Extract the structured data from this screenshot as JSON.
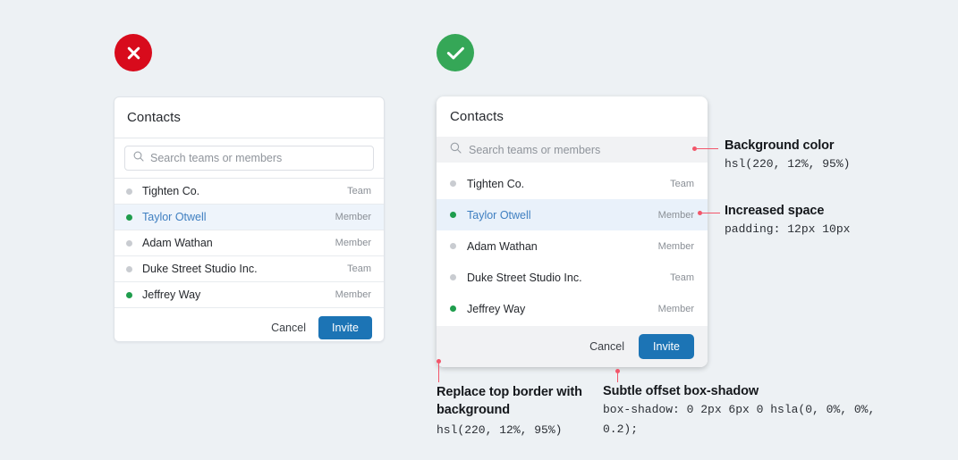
{
  "page": {
    "background_color": "#edf1f4"
  },
  "bad_example": {
    "badge": {
      "icon": "x-circle-icon",
      "color": "#d80b1c"
    },
    "card": {
      "title": "Contacts",
      "search": {
        "icon": "search-icon",
        "placeholder": "Search teams or members",
        "value": ""
      },
      "rows": [
        {
          "name": "Tighten Co.",
          "role": "Team",
          "status": "off",
          "selected": false
        },
        {
          "name": "Taylor Otwell",
          "role": "Member",
          "status": "on",
          "selected": true
        },
        {
          "name": "Adam Wathan",
          "role": "Member",
          "status": "off",
          "selected": false
        },
        {
          "name": "Duke Street Studio Inc.",
          "role": "Team",
          "status": "off",
          "selected": false
        },
        {
          "name": "Jeffrey Way",
          "role": "Member",
          "status": "on",
          "selected": false
        }
      ],
      "cancel_label": "Cancel",
      "invite_label": "Invite",
      "invite_color": "#1c74b5"
    }
  },
  "good_example": {
    "badge": {
      "icon": "check-circle-icon",
      "color": "#35a757"
    },
    "card": {
      "title": "Contacts",
      "search": {
        "icon": "search-icon",
        "placeholder": "Search teams or members",
        "value": ""
      },
      "rows": [
        {
          "name": "Tighten Co.",
          "role": "Team",
          "status": "off",
          "selected": false
        },
        {
          "name": "Taylor Otwell",
          "role": "Member",
          "status": "on",
          "selected": true
        },
        {
          "name": "Adam Wathan",
          "role": "Member",
          "status": "off",
          "selected": false
        },
        {
          "name": "Duke Street Studio Inc.",
          "role": "Team",
          "status": "off",
          "selected": false
        },
        {
          "name": "Jeffrey Way",
          "role": "Member",
          "status": "on",
          "selected": false
        }
      ],
      "cancel_label": "Cancel",
      "invite_label": "Invite",
      "invite_color": "#1c74b5"
    }
  },
  "annotations": [
    {
      "title": "Background color",
      "code": "hsl(220, 12%, 95%)"
    },
    {
      "title": "Increased space",
      "code": "padding: 12px 10px"
    },
    {
      "title": "Replace top border with background",
      "code": "hsl(220, 12%, 95%)"
    },
    {
      "title": "Subtle offset box-shadow",
      "code": "box-shadow: 0 2px 6px 0 hsla(0, 0%, 0%, 0.2);"
    }
  ],
  "leader_color": "#f2566a"
}
